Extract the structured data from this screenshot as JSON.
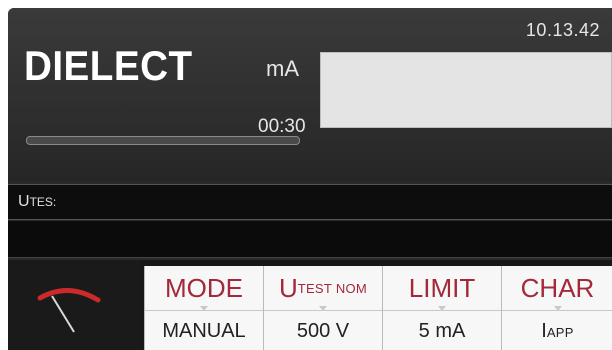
{
  "header": {
    "clock": "10.13.42",
    "function_title": "DIELECT",
    "unit": "mA",
    "timer": "00:30",
    "progress": 0
  },
  "status": {
    "utes_label": "UTES:"
  },
  "softkeys": [
    {
      "label": "MODE",
      "value": "MANUAL"
    },
    {
      "label": "UTEST NOM",
      "value": "500 V"
    },
    {
      "label": "LIMIT",
      "value": "5 mA"
    },
    {
      "label": "CHAR",
      "value": "IAPP"
    }
  ],
  "colors": {
    "softkey_label": "#a3283a",
    "gauge_needle": "#cc2a2a"
  }
}
